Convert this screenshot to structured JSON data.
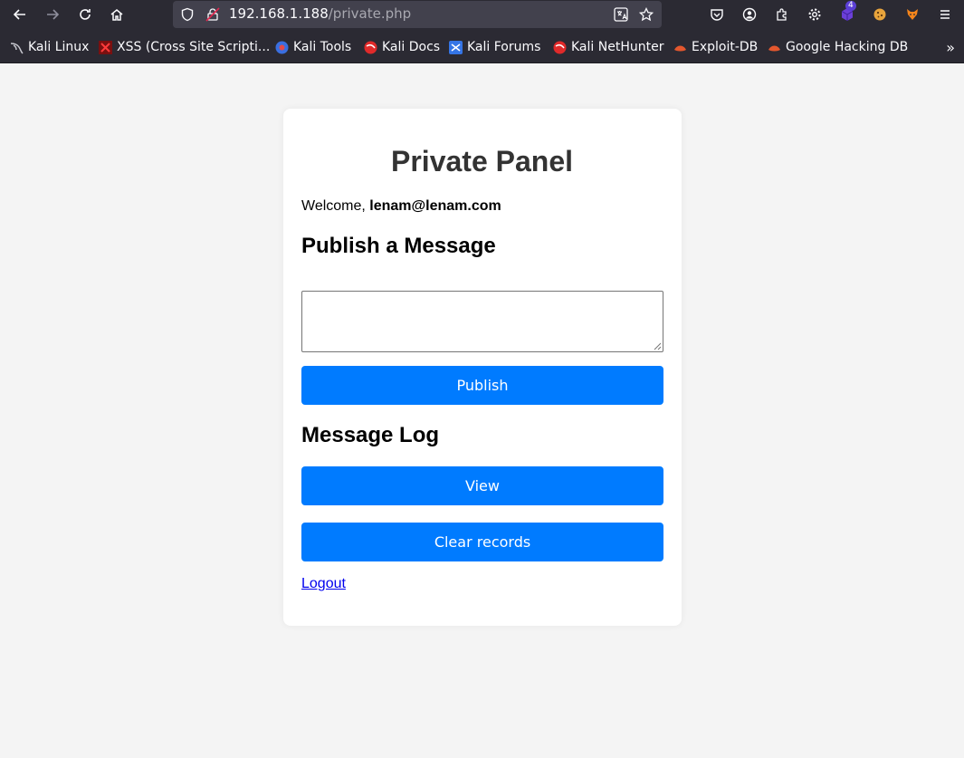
{
  "browser": {
    "url_host": "192.168.1.188",
    "url_path": "/private.php",
    "extension_badge": "4",
    "bookmarks": [
      {
        "label": "Kali Linux",
        "icon": "kali-dragon-icon"
      },
      {
        "label": "XSS (Cross Site Scripti...",
        "icon": "xss-icon"
      },
      {
        "label": "Kali Tools",
        "icon": "kali-tools-icon"
      },
      {
        "label": "Kali Docs",
        "icon": "kali-docs-icon"
      },
      {
        "label": "Kali Forums",
        "icon": "kali-forums-icon"
      },
      {
        "label": "Kali NetHunter",
        "icon": "kali-nethunter-icon"
      },
      {
        "label": "Exploit-DB",
        "icon": "exploit-db-icon"
      },
      {
        "label": "Google Hacking DB",
        "icon": "google-hacking-db-icon"
      }
    ]
  },
  "page": {
    "title": "Private Panel",
    "welcome_prefix": "Welcome, ",
    "user_email": "lenam@lenam.com",
    "publish_heading": "Publish a Message",
    "message_value": "",
    "publish_button": "Publish",
    "log_heading": "Message Log",
    "view_button": "View",
    "clear_button": "Clear records",
    "logout_link": "Logout"
  },
  "colors": {
    "primary_button": "#007bff",
    "page_background": "#f4f4f4",
    "toolbar_background": "#2b2a33"
  }
}
